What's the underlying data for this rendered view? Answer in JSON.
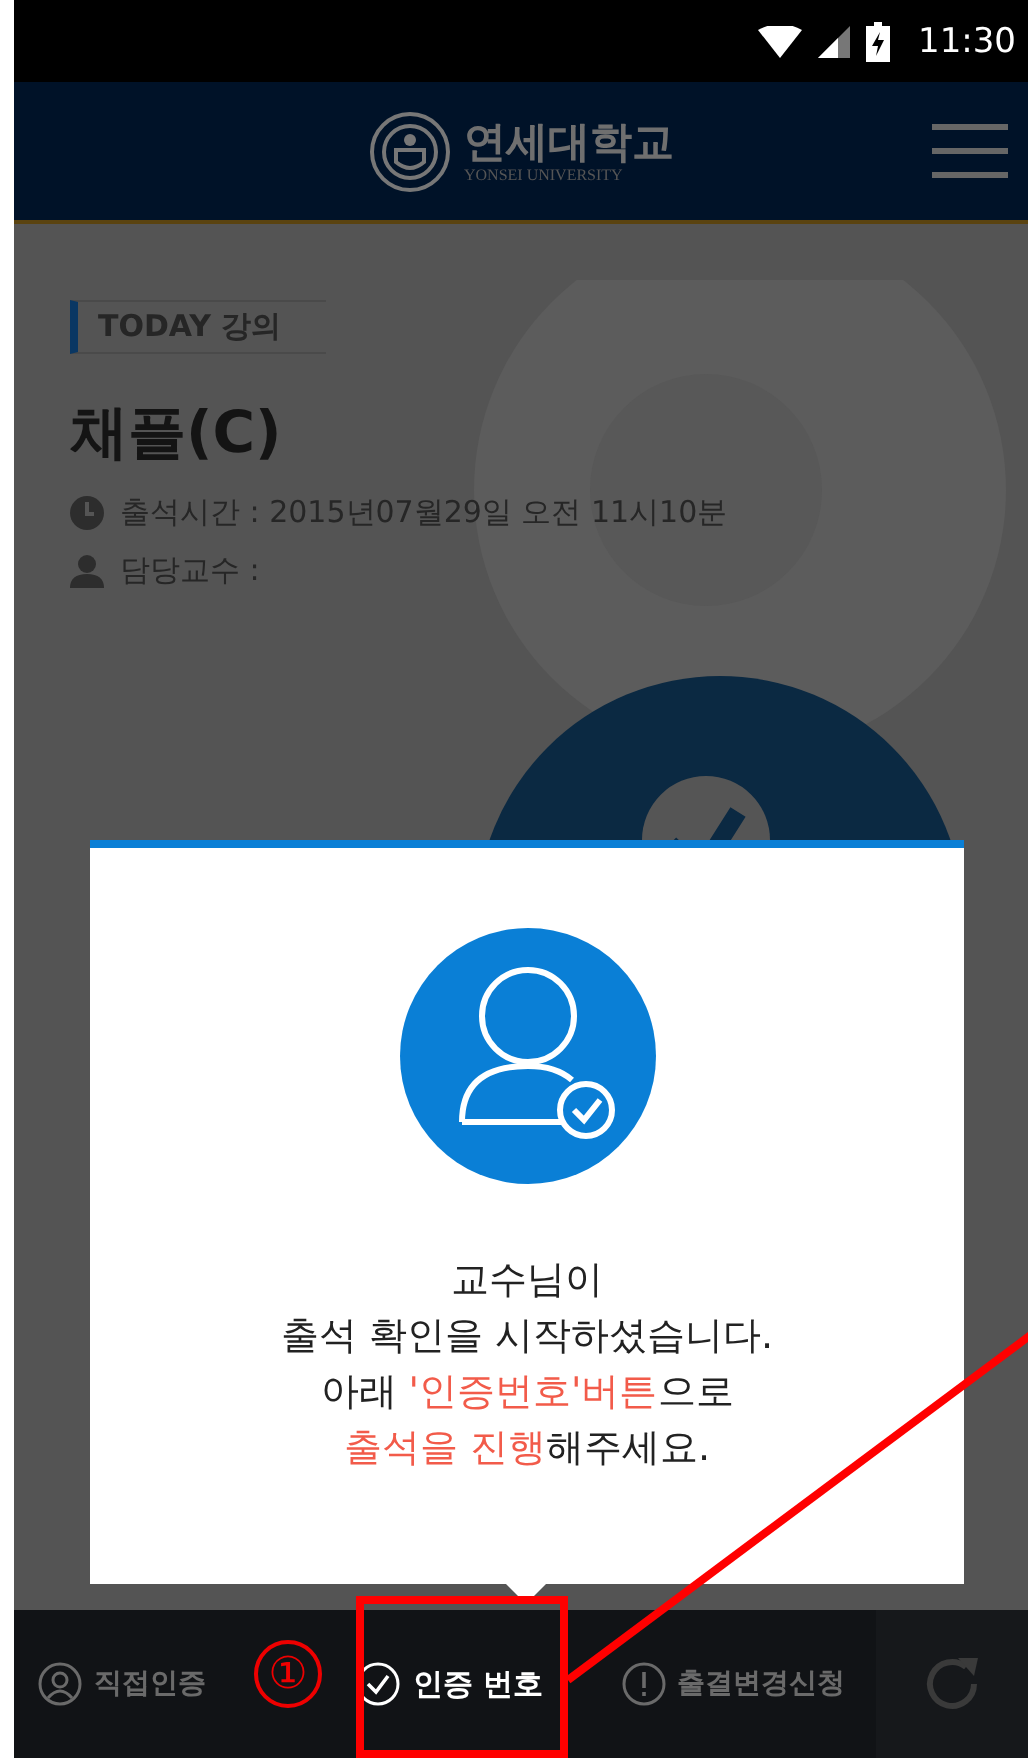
{
  "status_bar": {
    "time": "11:30"
  },
  "header": {
    "university_name": "연세대학교",
    "university_name_en": "YONSEI UNIVERSITY"
  },
  "lecture": {
    "badge": "TODAY 강의",
    "title": "채플(C)",
    "time_label": "출석시간 : 2015년07월29일 오전 11시10분",
    "professor_label": "담당교수 :"
  },
  "dialog": {
    "lines": [
      [
        {
          "text": "교수님이",
          "highlight": false
        }
      ],
      [
        {
          "text": "출석 확인을 시작하셨습니다.",
          "highlight": false
        }
      ],
      [
        {
          "text": "아래 ",
          "highlight": false
        },
        {
          "text": "'인증번호'버튼",
          "highlight": true
        },
        {
          "text": "으로",
          "highlight": false
        }
      ],
      [
        {
          "text": "출석을 진행",
          "highlight": true
        },
        {
          "text": "해주세요.",
          "highlight": false
        }
      ]
    ]
  },
  "bottom_bar": {
    "items": [
      {
        "label": "직접인증",
        "kind": "person",
        "selected": false
      },
      {
        "label": "인증 번호",
        "kind": "check",
        "selected": true
      },
      {
        "label": "출결변경신청",
        "kind": "alert",
        "selected": false
      }
    ]
  },
  "annotation": {
    "marker": "①"
  }
}
